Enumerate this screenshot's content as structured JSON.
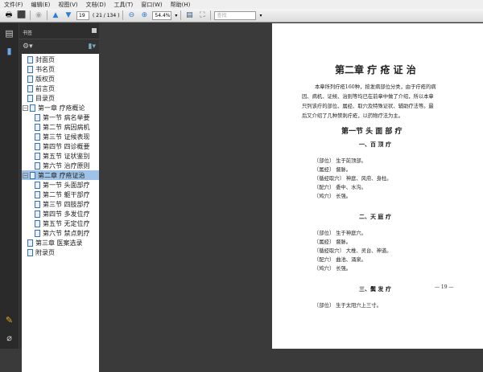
{
  "menu": [
    "文件(F)",
    "编辑(E)",
    "视图(V)",
    "文档(D)",
    "工具(T)",
    "窗口(W)",
    "帮助(H)"
  ],
  "toolbar": {
    "page_input": "19",
    "page_count": "( 21 / 134 )",
    "zoom": "54.4%",
    "search_placeholder": "查找"
  },
  "panel": {
    "title": "书签"
  },
  "bookmarks": [
    {
      "label": "封面页",
      "level": 0
    },
    {
      "label": "书名页",
      "level": 0
    },
    {
      "label": "版权页",
      "level": 0
    },
    {
      "label": "前言页",
      "level": 0
    },
    {
      "label": "目录页",
      "level": 0
    },
    {
      "label": "第一章  疗疮概论",
      "level": 0,
      "expanded": true
    },
    {
      "label": "第一节  病名举要",
      "level": 1
    },
    {
      "label": "第二节  病因病机",
      "level": 1
    },
    {
      "label": "第三节  证候表现",
      "level": 1
    },
    {
      "label": "第四节  四诊概要",
      "level": 1
    },
    {
      "label": "第五节  证状鉴别",
      "level": 1
    },
    {
      "label": "第六节  治疗原则",
      "level": 1
    },
    {
      "label": "第二章  疗疮证治",
      "level": 0,
      "expanded": true,
      "selected": true
    },
    {
      "label": "第一节  头面部疗",
      "level": 1
    },
    {
      "label": "第二节  躯干部疗",
      "level": 1
    },
    {
      "label": "第三节  四肢部疗",
      "level": 1
    },
    {
      "label": "第四节  多发位疗",
      "level": 1
    },
    {
      "label": "第五节  无定位疗",
      "level": 1
    },
    {
      "label": "第六节  禁点刺疗",
      "level": 1
    },
    {
      "label": "第三章  医案选录",
      "level": 0
    },
    {
      "label": "附录页",
      "level": 0
    }
  ],
  "document": {
    "chapter_title": "第二章  疔 疮 证 治",
    "intro": [
      "本章所列疔疮160种，按发病部位分类，由于疔疮的病",
      "因、病机、证候、治则等均已在前章中做了介绍，所以本章",
      "只列该疔的部位、属经、取穴及特殊证状、辅助疗法等。最",
      "后又介绍了几种禁刺疔疮，以药物疗法为主。"
    ],
    "section_title": "第一节  头 面 部 疔",
    "subsections": [
      {
        "title": "一、百  顶  疔",
        "lines": [
          "〔部位〕 生于前顶部。",
          "〔属经〕 督脉。",
          "〔循经取穴〕 神庭、风府、身柱。",
          "〔配穴〕 委中、水沟。",
          "〔鸠穴〕 长强。"
        ]
      },
      {
        "title": "二、天  庭  疔",
        "lines": [
          "〔部位〕 生于神庭穴。",
          "〔属经〕 督脉。",
          "〔循经取穴〕 大椎、灵台、神道。",
          "〔配穴〕 曲池、涌泉。",
          "〔鸠穴〕 长强。"
        ]
      },
      {
        "title": "三、鬓  发  疔",
        "lines": [
          "〔部位〕 生于太阳穴上三寸。"
        ]
      }
    ],
    "page_number": "— 19 —"
  }
}
